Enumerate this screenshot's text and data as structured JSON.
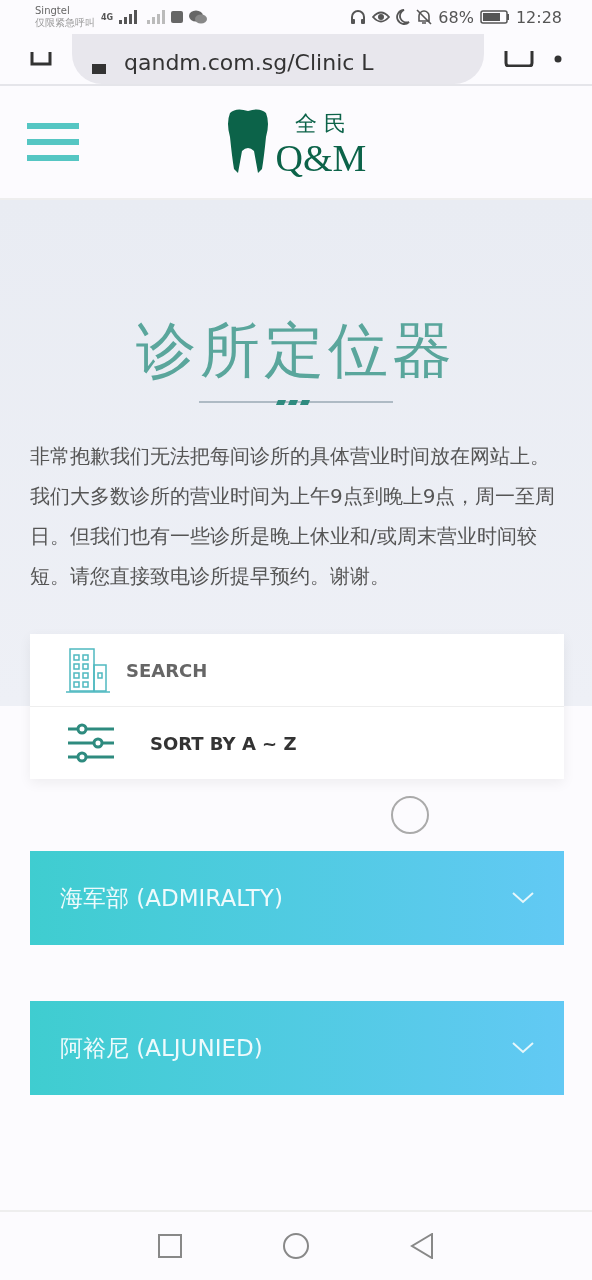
{
  "status_bar": {
    "carrier": "Singtel",
    "carrier_note": "仅限紧急呼叫",
    "network": "4G",
    "battery": "68%",
    "time": "12:28"
  },
  "address_bar": {
    "url": "qandm.com.sg/Clinic L"
  },
  "header": {
    "logo_cn": "全 民",
    "logo_en": "Q&M"
  },
  "page": {
    "title": "诊所定位器",
    "intro": "非常抱歉我们无法把每间诊所的具体营业时间放在网站上。我们大多数诊所的营业时间为上午9点到晚上9点，周一至周日。但我们也有一些诊所是晚上休业和/或周末营业时间较短。请您直接致电诊所提早预约。谢谢。"
  },
  "tools": [
    {
      "kind": "search",
      "label": "SEARCH"
    },
    {
      "kind": "sort",
      "label": "SORT BY A ~ Z"
    }
  ],
  "regions": [
    {
      "label": "海军部 (ADMIRALTY)",
      "expanded": false
    },
    {
      "label": "阿裕尼 (ALJUNIED)",
      "expanded": false
    }
  ]
}
